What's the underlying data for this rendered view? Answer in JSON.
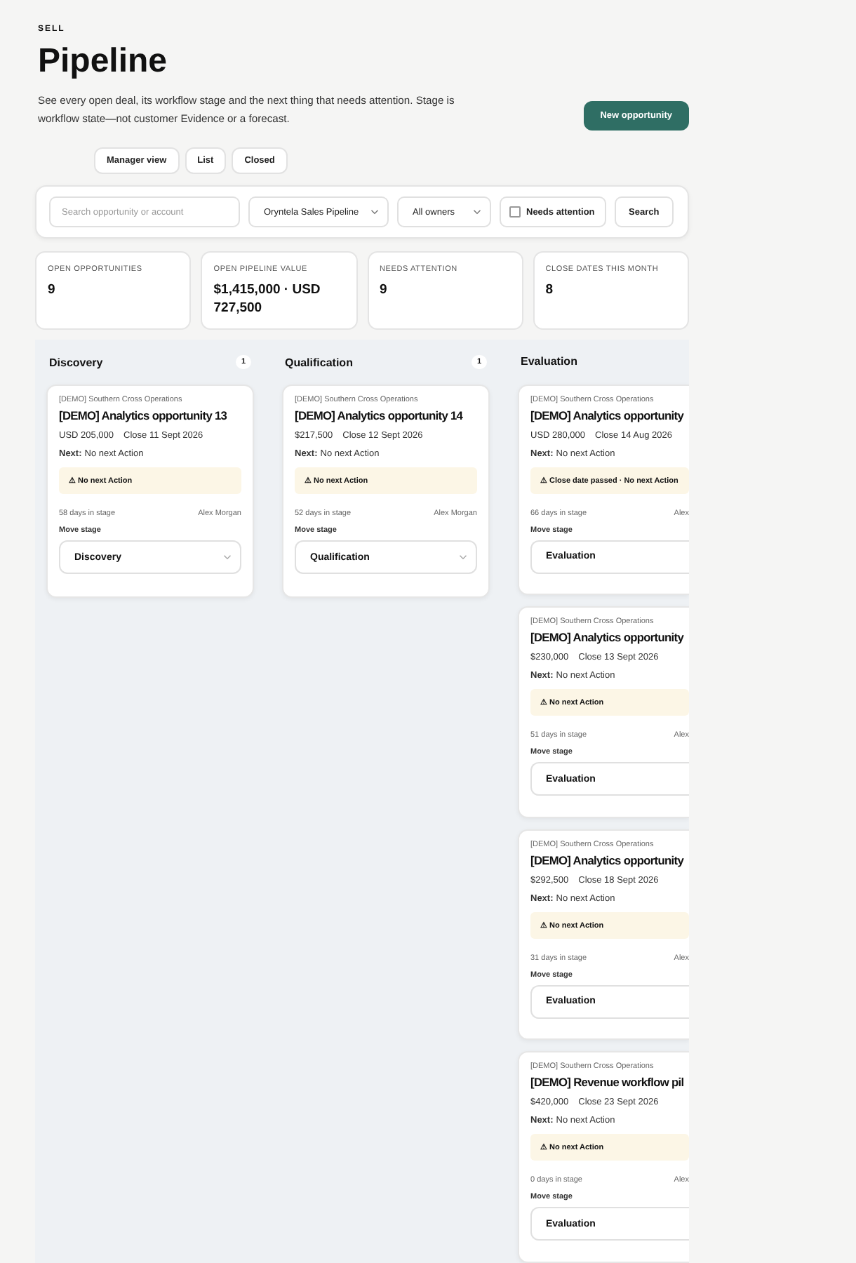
{
  "eyebrow": "SELL",
  "title": "Pipeline",
  "description": "See every open deal, its workflow stage and the next thing that needs attention. Stage is workflow state—not customer Evidence or a forecast.",
  "primary_button": "New opportunity",
  "tabs": [
    {
      "label": "Manager view",
      "selected": false
    },
    {
      "label": "List",
      "selected": false
    },
    {
      "label": "Closed",
      "selected": false
    }
  ],
  "filters": {
    "search": {
      "placeholder": "Search opportunity or account"
    },
    "pipeline": "Oryntela Sales Pipeline",
    "owner": "All owners",
    "needs_attention": {
      "label": "Needs attention",
      "checked": false
    },
    "button": "Search"
  },
  "stats": [
    {
      "label": "OPEN OPPORTUNITIES",
      "value": "9"
    },
    {
      "label": "OPEN PIPELINE VALUE",
      "value": "$1,415,000 · USD 727,500"
    },
    {
      "label": "NEEDS ATTENTION",
      "value": "9"
    },
    {
      "label": "CLOSE DATES THIS MONTH",
      "value": "8"
    }
  ],
  "columns": [
    {
      "name": "Discovery",
      "count": "1",
      "cards": [
        {
          "account": "[DEMO] Southern Cross Operations",
          "title": "[DEMO] Analytics opportunity 13",
          "amount": "USD 205,000",
          "close": "Close 11 Sept 2026",
          "next_label": "Next:",
          "next_value": "No next Action",
          "warning": "⚠ No next Action",
          "days": "58 days in stage",
          "owner": "Alex Morgan",
          "move_label": "Move stage",
          "stage": "Discovery",
          "stage_caret": true
        }
      ]
    },
    {
      "name": "Qualification",
      "count": "1",
      "cards": [
        {
          "account": "[DEMO] Southern Cross Operations",
          "title": "[DEMO] Analytics opportunity 14",
          "amount": "$217,500",
          "close": "Close 12 Sept 2026",
          "next_label": "Next:",
          "next_value": "No next Action",
          "warning": "⚠ No next Action",
          "days": "52 days in stage",
          "owner": "Alex Morgan",
          "move_label": "Move stage",
          "stage": "Qualification",
          "stage_caret": true
        }
      ]
    },
    {
      "name": "Evaluation",
      "cards": [
        {
          "account": "[DEMO] Southern Cross Operations",
          "title": "[DEMO] Analytics opportunity",
          "amount": "USD 280,000",
          "close": "Close 14 Aug 2026",
          "next_label": "Next:",
          "next_value": "No next Action",
          "warning": "⚠ Close date passed · No next Action",
          "days": "66 days in stage",
          "owner": "Alex",
          "move_label": "Move stage",
          "stage": "Evaluation",
          "stage_caret": false
        },
        {
          "account": "[DEMO] Southern Cross Operations",
          "title": "[DEMO] Analytics opportunity",
          "amount": "$230,000",
          "close": "Close 13 Sept 2026",
          "next_label": "Next:",
          "next_value": "No next Action",
          "warning": "⚠ No next Action",
          "days": "51 days in stage",
          "owner": "Alex",
          "move_label": "Move stage",
          "stage": "Evaluation",
          "stage_caret": false
        },
        {
          "account": "[DEMO] Southern Cross Operations",
          "title": "[DEMO] Analytics opportunity",
          "amount": "$292,500",
          "close": "Close 18 Sept 2026",
          "next_label": "Next:",
          "next_value": "No next Action",
          "warning": "⚠ No next Action",
          "days": "31 days in stage",
          "owner": "Alex",
          "move_label": "Move stage",
          "stage": "Evaluation",
          "stage_caret": false
        },
        {
          "account": "[DEMO] Southern Cross Operations",
          "title": "[DEMO] Revenue workflow pil",
          "amount": "$420,000",
          "close": "Close 23 Sept 2026",
          "next_label": "Next:",
          "next_value": "No next Action",
          "warning": "⚠ No next Action",
          "days": "0 days in stage",
          "owner": "Alex",
          "move_label": "Move stage",
          "stage": "Evaluation",
          "stage_caret": false
        }
      ]
    }
  ]
}
